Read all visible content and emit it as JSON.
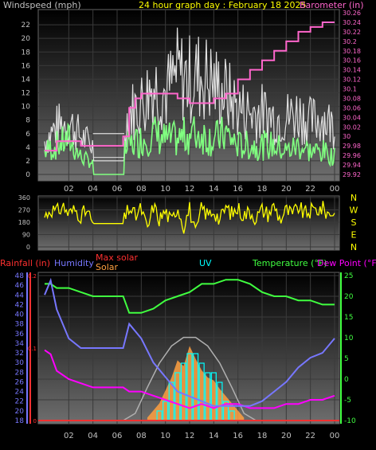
{
  "header": {
    "windspeed_title": "Windspeed (mph)",
    "graph_title": "24 hour graph day : February 18 2025",
    "barometer_title": "Barometer (in)"
  },
  "legend": {
    "rainfall": "Rainfall (in)",
    "humidity": "Humidity",
    "max_solar": "Max solar",
    "solar": "Solar",
    "uv": "UV",
    "temperature": "Temperature (°F)",
    "dew_point": "Dew Point (°F)"
  },
  "colors": {
    "windspeed_title": "#c0c0c0",
    "graph_title": "#ffff00",
    "barometer": "#ff66cc",
    "gust": "#e0e0e0",
    "avg_wind": "#80ff80",
    "direction": "#ffff00",
    "rainfall": "#ff3030",
    "humidity": "#7777ff",
    "max_solar": "#ff3030",
    "solar": "#ffa040",
    "uv": "#00ffff",
    "temperature": "#40ff40",
    "dew_point": "#ff00ff"
  },
  "chart_data": [
    {
      "type": "line",
      "panel": "wind_barometer",
      "x_tick_labels": [
        "02",
        "04",
        "06",
        "08",
        "10",
        "12",
        "14",
        "16",
        "18",
        "20",
        "22",
        "00"
      ],
      "xlim": [
        0,
        24
      ],
      "ylabel_left": "Windspeed (mph)",
      "ylim_left": [
        0,
        24
      ],
      "y_ticks_left": [
        "0",
        "2",
        "4",
        "6",
        "8",
        "10",
        "12",
        "14",
        "16",
        "18",
        "20",
        "22"
      ],
      "ylabel_right": "Barometer (in)",
      "ylim_right": [
        29.92,
        30.26
      ],
      "y_ticks_right": [
        "29.92",
        "29.94",
        "29.96",
        "29.98",
        "30",
        "30.02",
        "30.04",
        "30.06",
        "30.08",
        "30.1",
        "30.12",
        "30.14",
        "30.16",
        "30.18",
        "30.2",
        "30.22",
        "30.24",
        "30.26"
      ],
      "series": [
        {
          "x": [
            0,
            1,
            2,
            3,
            4,
            5,
            6,
            7,
            8,
            9,
            10,
            11,
            12,
            13,
            14,
            15,
            16,
            17,
            18,
            19,
            20,
            21,
            22,
            23,
            24
          ],
          "values": [
            7,
            10,
            11,
            8,
            6,
            6,
            6,
            13,
            15,
            19,
            17,
            21,
            20,
            21,
            19,
            17,
            14,
            13,
            13,
            12,
            12,
            13,
            11,
            12,
            10
          ]
        },
        {
          "x": [
            0,
            1,
            2,
            3,
            4,
            5,
            6,
            7,
            8,
            9,
            10,
            11,
            12,
            13,
            14,
            15,
            16,
            17,
            18,
            19,
            20,
            21,
            22,
            23,
            24
          ],
          "values": [
            4,
            5,
            6,
            3,
            2,
            2,
            2,
            5,
            6,
            7,
            6,
            6,
            7,
            7,
            6,
            7,
            5,
            5,
            5,
            5,
            4,
            5,
            4,
            4,
            3
          ]
        },
        {
          "x": [
            0,
            1,
            2,
            3,
            4,
            5,
            6,
            6.5,
            7,
            7.5,
            8,
            9,
            10,
            11,
            12,
            13,
            14,
            15,
            16,
            17,
            18,
            19,
            20,
            21,
            22,
            23,
            24
          ],
          "values": [
            29.97,
            29.99,
            29.99,
            29.98,
            29.98,
            29.98,
            29.98,
            30.0,
            30.06,
            30.08,
            30.09,
            30.09,
            30.09,
            30.08,
            30.07,
            30.07,
            30.08,
            30.09,
            30.12,
            30.14,
            30.16,
            30.18,
            30.2,
            30.22,
            30.23,
            30.24,
            30.24
          ]
        }
      ]
    },
    {
      "type": "line",
      "panel": "wind_direction",
      "x_tick_labels": [
        "02",
        "04",
        "06",
        "08",
        "10",
        "12",
        "14",
        "16",
        "18",
        "20",
        "22",
        "00"
      ],
      "xlim": [
        0,
        24
      ],
      "ylim": [
        0,
        360
      ],
      "y_ticks": [
        "0",
        "90",
        "180",
        "270",
        "360"
      ],
      "compass_labels": [
        "N",
        "W",
        "S",
        "E",
        "N"
      ],
      "series": [
        {
          "x": [
            0,
            0.5,
            1,
            1.5,
            2,
            2.5,
            3,
            3.5,
            4,
            5,
            6,
            6.5,
            7,
            7.5,
            8,
            8.5,
            9,
            9.5,
            10,
            10.5,
            11,
            11.5,
            12,
            12.5,
            13,
            13.5,
            14,
            14.5,
            15,
            15.5,
            16,
            16.5,
            17,
            17.5,
            18,
            18.5,
            19,
            19.5,
            20,
            20.5,
            21,
            21.5,
            22,
            22.5,
            23,
            23.5,
            24
          ],
          "values": [
            220,
            280,
            250,
            300,
            240,
            270,
            230,
            260,
            170,
            170,
            170,
            170,
            290,
            220,
            280,
            120,
            300,
            200,
            260,
            180,
            300,
            150,
            280,
            80,
            290,
            230,
            270,
            190,
            290,
            240,
            280,
            230,
            260,
            210,
            270,
            240,
            300,
            200,
            270,
            230,
            290,
            240,
            260,
            270,
            280,
            240,
            260
          ]
        }
      ]
    },
    {
      "type": "line",
      "panel": "temp_humidity_solar",
      "x_tick_labels": [
        "02",
        "04",
        "06",
        "08",
        "10",
        "12",
        "14",
        "16",
        "18",
        "20",
        "22",
        "00"
      ],
      "xlim": [
        0,
        24
      ],
      "ylabel_left_rain": "Rainfall (in)",
      "y_ticks_rain": [
        "0",
        "0.1",
        "0.2"
      ],
      "ylim_rain": [
        0,
        0.2
      ],
      "ylabel_left_humidity": "Humidity",
      "ylim_humidity": [
        18,
        48
      ],
      "y_ticks_humidity": [
        "18",
        "20",
        "22",
        "24",
        "26",
        "28",
        "30",
        "32",
        "34",
        "36",
        "38",
        "40",
        "42",
        "44",
        "46",
        "48"
      ],
      "ylabel_right": "Temperature (°F)",
      "ylim_right": [
        -10,
        25
      ],
      "y_ticks_right": [
        "-10",
        "-5",
        "0",
        "5",
        "10",
        "15",
        "20",
        "25"
      ],
      "series": [
        {
          "x": [
            0,
            0.5,
            1,
            2,
            3,
            4,
            5,
            6,
            6.5,
            7,
            8,
            9,
            10,
            11,
            12,
            13,
            14,
            15,
            16,
            17,
            18,
            19,
            20,
            21,
            22,
            23,
            24
          ],
          "values": [
            23,
            23,
            22,
            22,
            21,
            20,
            20,
            20,
            20,
            16,
            16,
            17,
            19,
            20,
            21,
            23,
            23,
            24,
            24,
            23,
            21,
            20,
            20,
            19,
            19,
            18,
            18
          ]
        },
        {
          "x": [
            0,
            0.5,
            1,
            2,
            3,
            4,
            5,
            6,
            6.5,
            7,
            8,
            9,
            10,
            11,
            12,
            13,
            14,
            15,
            16,
            17,
            18,
            19,
            20,
            21,
            22,
            23,
            24
          ],
          "values": [
            7,
            6,
            2,
            0,
            -1,
            -2,
            -2,
            -2,
            -2,
            -3,
            -3,
            -4,
            -5,
            -6,
            -7,
            -6,
            -7,
            -6,
            -6,
            -7,
            -7,
            -7,
            -6,
            -6,
            -5,
            -5,
            -4
          ]
        },
        {
          "x": [
            0,
            0.5,
            1,
            2,
            3,
            4,
            5,
            6,
            6.5,
            7,
            8,
            9,
            10,
            11,
            12,
            13,
            14,
            15,
            16,
            17,
            18,
            19,
            20,
            21,
            22,
            23,
            24
          ],
          "values": [
            44,
            47,
            41,
            35,
            33,
            33,
            33,
            33,
            33,
            38,
            35,
            30,
            27,
            24,
            23,
            22,
            21,
            21,
            21,
            21,
            22,
            24,
            26,
            29,
            31,
            32,
            35
          ]
        },
        {
          "x": [
            6.5,
            7.5,
            8.5,
            9.5,
            10.5,
            11.5,
            12.5,
            13.5,
            14.5,
            15.5,
            16.5,
            17.5
          ],
          "values": [
            0,
            50,
            230,
            400,
            520,
            580,
            580,
            520,
            400,
            230,
            50,
            0
          ]
        },
        {
          "x": [
            8.5,
            9.5,
            10.5,
            11,
            11.5,
            12,
            12.5,
            13,
            13.5,
            14,
            14.5,
            15.5,
            16.5
          ],
          "values": [
            20,
            120,
            300,
            420,
            380,
            520,
            430,
            350,
            300,
            280,
            220,
            120,
            20
          ]
        },
        {
          "x": [
            9.5,
            10,
            10.5,
            11,
            11.5,
            12,
            12.5,
            13,
            13.5,
            14,
            14.5,
            15,
            15.5
          ],
          "values": [
            1,
            2,
            4,
            5,
            6,
            7,
            7,
            6,
            5,
            5,
            4,
            2,
            1
          ]
        }
      ]
    }
  ]
}
